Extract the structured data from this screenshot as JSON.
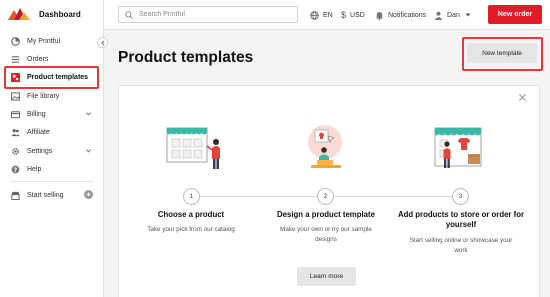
{
  "brand": {
    "name": "Dashboard"
  },
  "sidebar": {
    "items": [
      {
        "label": "My Printful",
        "icon": "pie-chart-icon"
      },
      {
        "label": "Orders",
        "icon": "list-icon"
      },
      {
        "label": "Product templates",
        "icon": "templates-icon"
      },
      {
        "label": "File library",
        "icon": "image-icon"
      },
      {
        "label": "Billing",
        "icon": "card-icon"
      },
      {
        "label": "Affiliate",
        "icon": "people-icon"
      },
      {
        "label": "Settings",
        "icon": "gear-icon"
      },
      {
        "label": "Help",
        "icon": "help-icon"
      }
    ],
    "start_selling": "Start selling",
    "add_symbol": "+"
  },
  "topbar": {
    "search_placeholder": "Search Printful",
    "language": "EN",
    "currency": "USD",
    "notifications": "Notifications",
    "user": "Dan",
    "new_order": "New order"
  },
  "main": {
    "title": "Product templates",
    "new_template": "New template",
    "steps": [
      {
        "num": "1",
        "title": "Choose a product",
        "desc": [
          "Take your pick from our catalog"
        ]
      },
      {
        "num": "2",
        "title": "Design a product template",
        "desc": [
          "Make your own or try our sample",
          "designs"
        ]
      },
      {
        "num": "3",
        "title": [
          "Add products to store or order for",
          "yourself"
        ],
        "desc": [
          "Start selling online or showcase your",
          "work"
        ]
      }
    ],
    "learn_more": "Learn more"
  },
  "colors": {
    "accent": "#e11d2a",
    "highlight": "#e5383b",
    "teal": "#39b9a6"
  }
}
